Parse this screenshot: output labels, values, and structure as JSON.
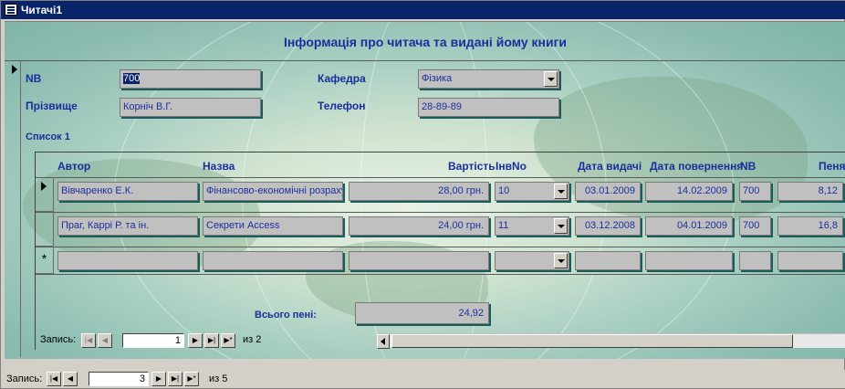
{
  "window": {
    "title": "Читачі1"
  },
  "form": {
    "title": "Інформація про читача та видані йому книги",
    "fields": {
      "nb_label": "NB",
      "nb_value": "700",
      "surname_label": "Прізвище",
      "surname_value": "Корніч В.Г.",
      "dept_label": "Кафедра",
      "dept_value": "Фізика",
      "phone_label": "Телефон",
      "phone_value": "28-89-89"
    },
    "subform_label": "Список 1",
    "columns": [
      "Автор",
      "Назва",
      "Вартість",
      "ІнвNo",
      "Дата видачі",
      "Дата повернення",
      "NB",
      "Пеня"
    ],
    "rows": [
      {
        "author": "Вівчаренко Е.К.",
        "title": "Фінансово-економічні розрахунк",
        "cost": "28,00 грн.",
        "inv": "10",
        "issue_date": "03.01.2009",
        "return_date": "14.02.2009",
        "nb": "700",
        "fine": "8,12"
      },
      {
        "author": "Праг, Каррі Р. та ін.",
        "title": "Секрети Access",
        "cost": "24,00 грн.",
        "inv": "11",
        "issue_date": "03.12.2008",
        "return_date": "04.01.2009",
        "nb": "700",
        "fine": "16,8"
      }
    ],
    "new_row_marker": "*",
    "total_label": "Всього пені:",
    "total_value": "24,92"
  },
  "sub_nav": {
    "label": "Запись:",
    "current": "1",
    "of_text": "из 2"
  },
  "main_nav": {
    "label": "Запись:",
    "current": "3",
    "of_text": "из 5"
  },
  "nav_glyphs": {
    "first": "|◀",
    "prev": "◀",
    "next": "▶",
    "last": "▶|",
    "new": "▶*"
  }
}
